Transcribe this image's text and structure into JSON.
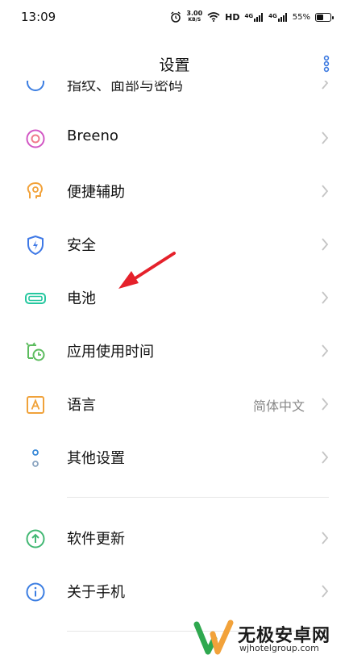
{
  "status_bar": {
    "time": "13:09",
    "speed_value": "3.00",
    "speed_unit": "KB/S",
    "hd": "HD",
    "network_1": "4G",
    "network_2": "4G",
    "battery": "55%",
    "battery_level": 0.55
  },
  "header": {
    "title": "设置"
  },
  "partial_item": {
    "label": "指纹、面部与密码"
  },
  "items": [
    {
      "label": "Breeno",
      "icon": "breeno-icon",
      "value": ""
    },
    {
      "label": "便捷辅助",
      "icon": "accessibility-icon",
      "value": ""
    },
    {
      "label": "安全",
      "icon": "security-shield-icon",
      "value": ""
    },
    {
      "label": "电池",
      "icon": "battery-icon",
      "value": ""
    },
    {
      "label": "应用使用时间",
      "icon": "app-usage-time-icon",
      "value": ""
    },
    {
      "label": "语言",
      "icon": "language-icon",
      "value": "简体中文"
    },
    {
      "label": "其他设置",
      "icon": "other-settings-icon",
      "value": ""
    }
  ],
  "items_2": [
    {
      "label": "软件更新",
      "icon": "software-update-icon"
    },
    {
      "label": "关于手机",
      "icon": "about-phone-icon"
    }
  ],
  "watermark": {
    "brand": "无极安卓网",
    "url": "wjhotelgroup.com"
  },
  "colors": {
    "chevron": "#c4c4c4",
    "arrow": "#e5212b",
    "breeno": "#d257c4",
    "accessibility": "#f2a23a",
    "security": "#3f79e6",
    "battery": "#25c79f",
    "app_usage": "#5cbc5e",
    "language": "#f0a23a",
    "other": "#3a8ad8",
    "update": "#43b874",
    "about": "#3c7ee2"
  }
}
